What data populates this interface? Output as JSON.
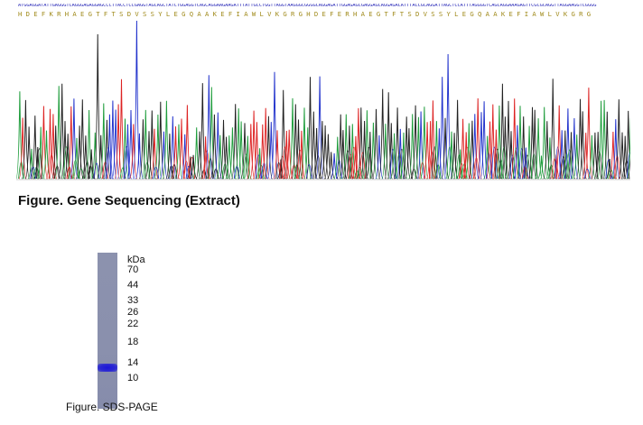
{
  "sequencing": {
    "dna_sequence": "ATGGAGGATATTGAGGGTCAGGGAGAGGAGCCCTTACCTCCGAGGTAGCAGCTATCTGGAGGTCAGCAGGAAGAAGATTTATTGCCTGGTTAGGTAAGGGCGGGGCAGGAGATTGGAGAGCGAGGAGCAGGAGACATTTACCGCAGGATTAGCTCCATTTAGGGGTCAGCAGGAAAGAGTTCGCGCAGGTTAGGAAGGTCGGGG",
    "protein_sequence": "HDEFKRHAEGTFTSDVSSYLEGQAAKEFIAWLVKGRGHDEFERHAEGTFTSDVSSYLEGQAAKEFIAWLVKGRG",
    "colors": {
      "A": "#1f9d3c",
      "C": "#2233cc",
      "G": "#222222",
      "T": "#dd2222",
      "dna_text": "#2a2ab8",
      "protein_text": "#a08a1a"
    },
    "caption": "Figure. Gene Sequencing (Extract)"
  },
  "gel": {
    "unit_label": "kDa",
    "markers": [
      "70",
      "44",
      "33",
      "26",
      "22",
      "18",
      "14",
      "10"
    ],
    "lane_color": "#8a90ad",
    "band_color": "#2420d0",
    "caption": "Figure. SDS-PAGE"
  }
}
